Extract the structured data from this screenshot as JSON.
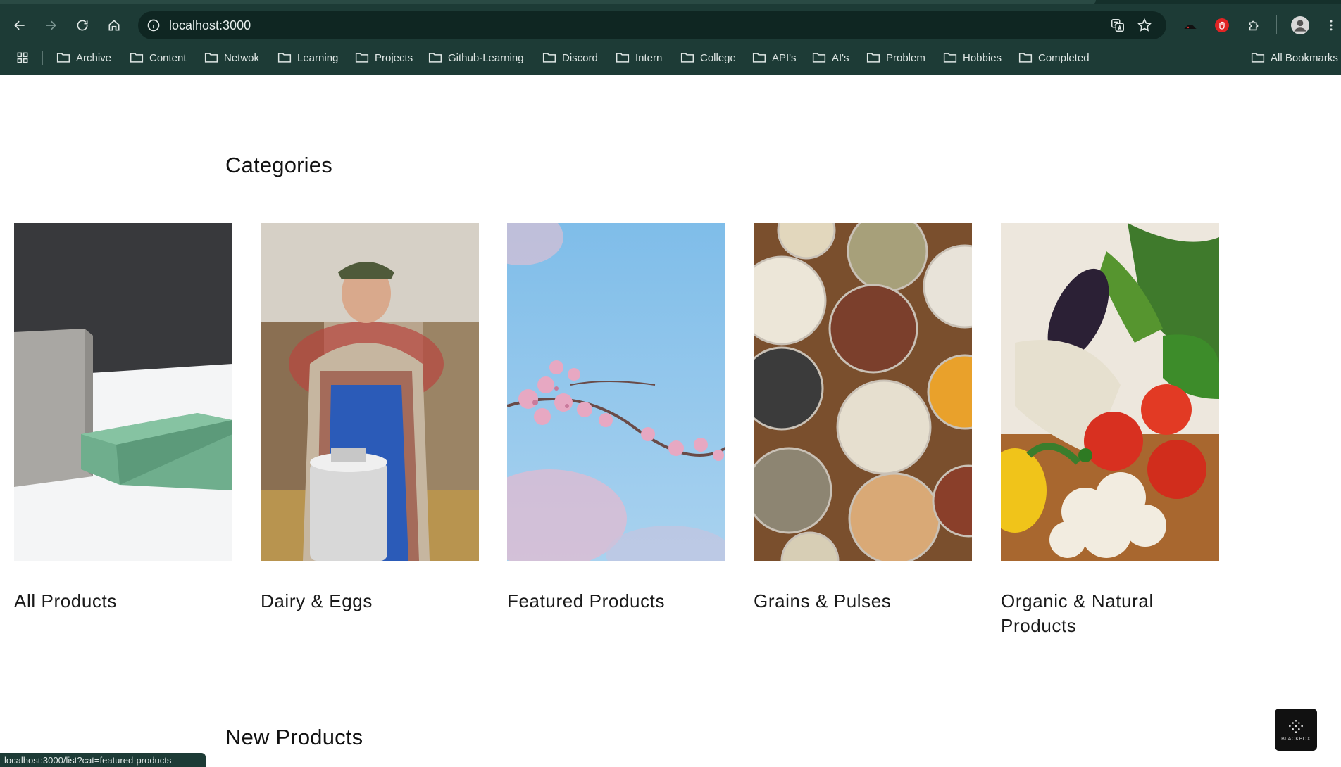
{
  "browser": {
    "url": "localhost:3000",
    "bookmarks": [
      "Archive",
      "Content",
      "Netwok",
      "Learning",
      "Projects",
      "Github-Learning",
      "Discord",
      "Intern",
      "College",
      "API's",
      "AI's",
      "Problem",
      "Hobbies",
      "Completed"
    ],
    "all_bookmarks_label": "All Bookmarks",
    "status_url": "localhost:3000/list?cat=featured-products"
  },
  "page": {
    "categories_title": "Categories",
    "new_products_title": "New Products",
    "categories": [
      {
        "label": "All Products"
      },
      {
        "label": "Dairy & Eggs"
      },
      {
        "label": "Featured Products"
      },
      {
        "label": "Grains & Pulses"
      },
      {
        "label": "Organic & Natural Products"
      }
    ],
    "badge_label": "BLACKBOX"
  }
}
